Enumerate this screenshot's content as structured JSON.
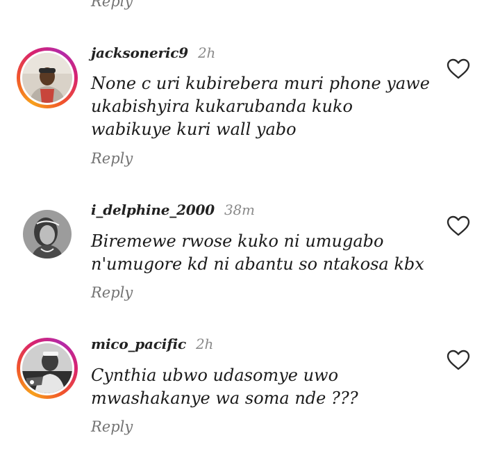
{
  "top_reply": "Reply",
  "comments": [
    {
      "username": "jacksoneric9",
      "time": "2h",
      "text": "None c uri kubirebera muri phone yawe ukabishyira kukarubanda kuko wabikuye kuri wall yabo",
      "reply_label": "Reply",
      "avatar_ring": "story",
      "like_icon": "heart-outline-icon"
    },
    {
      "username": "i_delphine_2000",
      "time": "38m",
      "text": "Biremewe rwose kuko ni umugabo n'umugore kd ni abantu so ntakosa kbx",
      "reply_label": "Reply",
      "avatar_ring": "none",
      "like_icon": "heart-outline-icon"
    },
    {
      "username": "mico_pacific",
      "time": "2h",
      "text": "Cynthia ubwo udasomye uwo mwashakanye wa soma nde ???",
      "reply_label": "Reply",
      "avatar_ring": "story",
      "like_icon": "heart-outline-icon"
    }
  ],
  "colors": {
    "story_ring_start": "#f7a01c",
    "story_ring_end": "#b32aa9",
    "secondary_text": "#737373"
  }
}
